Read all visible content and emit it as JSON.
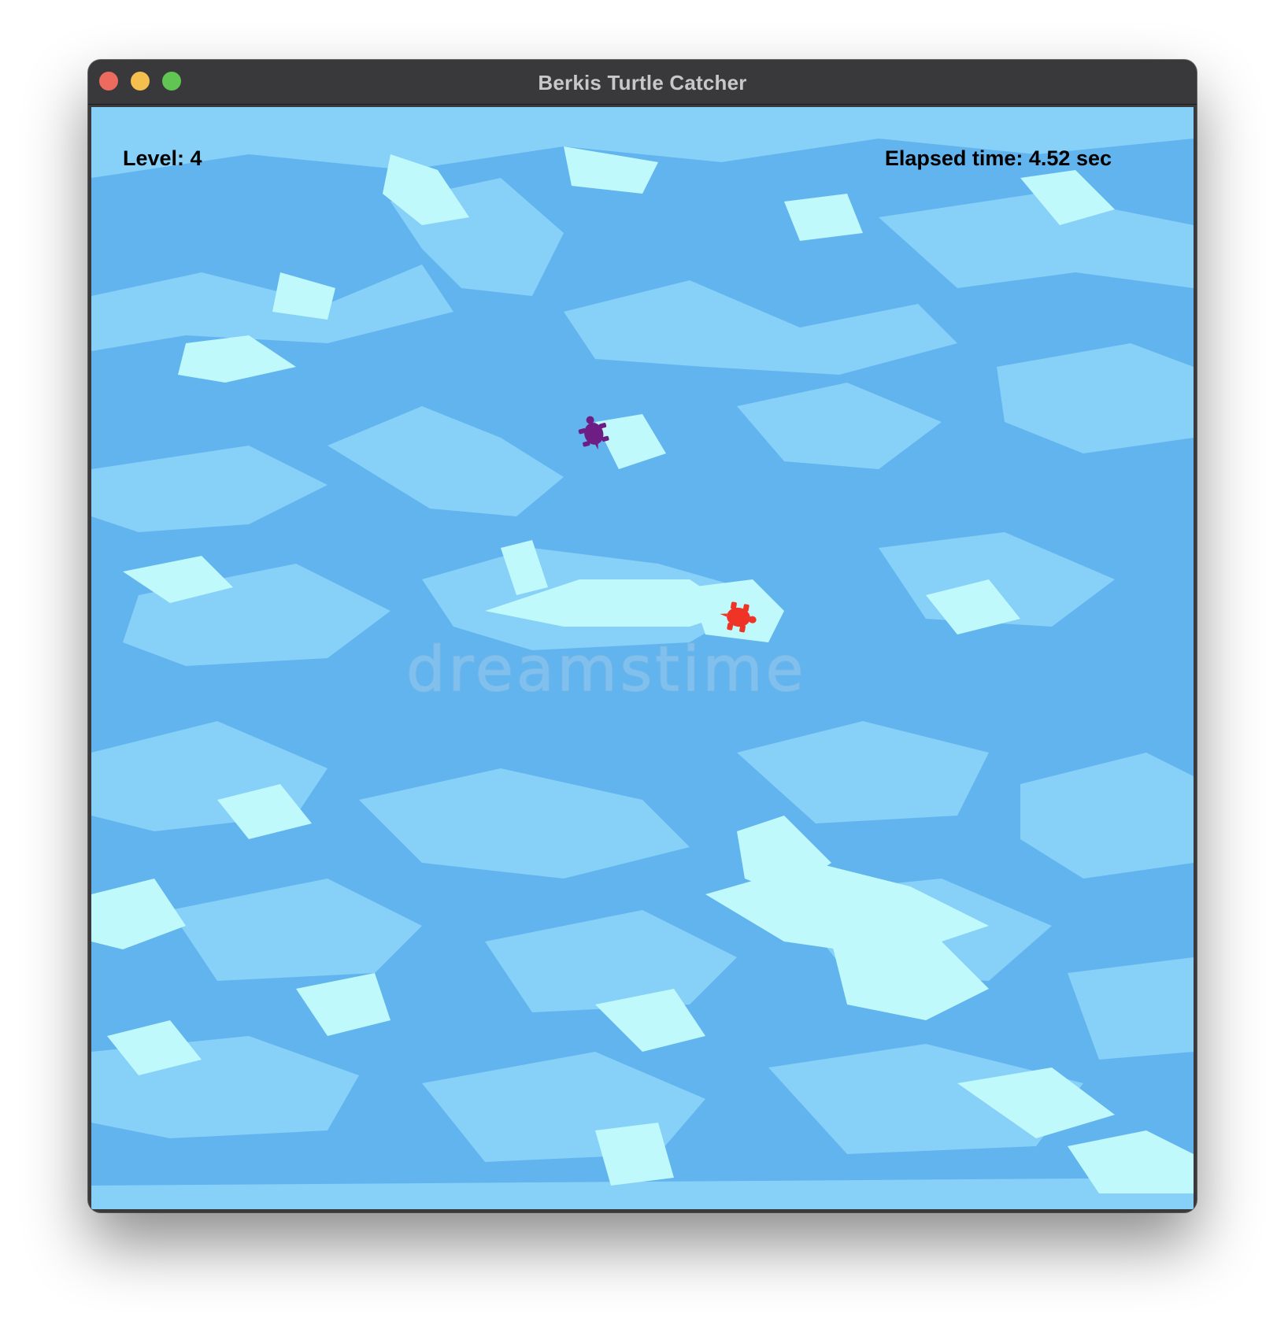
{
  "window": {
    "title": "Berkis Turtle Catcher"
  },
  "hud": {
    "level_text": "Level: 4",
    "elapsed_text": "Elapsed time: 4.52 sec"
  },
  "watermark": "dreamstime",
  "colors": {
    "water_dark": "#62b4ee",
    "water_mid": "#87d0f8",
    "water_light": "#c0f9fb",
    "player_turtle": "#ef3326",
    "target_turtle": "#6e1d85"
  },
  "sprites": {
    "player": {
      "icon": "turtle-icon",
      "color": "#ef3326"
    },
    "target": {
      "icon": "turtle-icon",
      "color": "#6e1d85"
    }
  }
}
